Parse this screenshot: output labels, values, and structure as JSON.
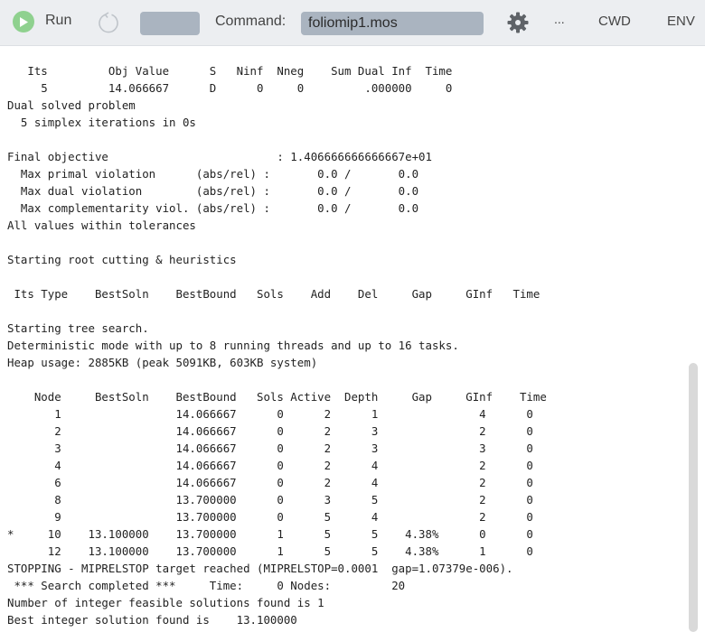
{
  "toolbar": {
    "run_label": "Run",
    "command_label": "Command:",
    "command_value": "foliomip1.mos",
    "more_label": "...",
    "cwd_label": "CWD",
    "env_label": "ENV",
    "icons": [
      "play-icon",
      "reload-icon",
      "gear-icon"
    ],
    "colors": {
      "toolbar_bg": "#eceef1",
      "field_bg": "#aab4c0",
      "run_green": "#8fd18f"
    }
  },
  "console": {
    "lines": [
      "   Its         Obj Value      S   Ninf  Nneg    Sum Dual Inf  Time",
      "     5         14.066667      D      0     0         .000000     0",
      "Dual solved problem",
      "  5 simplex iterations in 0s",
      "",
      "Final objective                         : 1.406666666666667e+01",
      "  Max primal violation      (abs/rel) :       0.0 /       0.0",
      "  Max dual violation        (abs/rel) :       0.0 /       0.0",
      "  Max complementarity viol. (abs/rel) :       0.0 /       0.0",
      "All values within tolerances",
      "",
      "Starting root cutting & heuristics",
      "",
      " Its Type    BestSoln    BestBound   Sols    Add    Del     Gap     GInf   Time",
      "",
      "Starting tree search.",
      "Deterministic mode with up to 8 running threads and up to 16 tasks.",
      "Heap usage: 2885KB (peak 5091KB, 603KB system)",
      "",
      "    Node     BestSoln    BestBound   Sols Active  Depth     Gap     GInf    Time",
      "       1                 14.066667      0      2      1               4      0",
      "       2                 14.066667      0      2      3               2      0",
      "       3                 14.066667      0      2      3               3      0",
      "       4                 14.066667      0      2      4               2      0",
      "       6                 14.066667      0      2      4               2      0",
      "       8                 13.700000      0      3      5               2      0",
      "       9                 13.700000      0      5      4               2      0",
      "*     10    13.100000    13.700000      1      5      5    4.38%      0      0",
      "      12    13.100000    13.700000      1      5      5    4.38%      1      0",
      "STOPPING - MIPRELSTOP target reached (MIPRELSTOP=0.0001  gap=1.07379e-006).",
      " *** Search completed ***     Time:     0 Nodes:         20",
      "Number of integer feasible solutions found is 1",
      "Best integer solution found is    13.100000"
    ]
  }
}
